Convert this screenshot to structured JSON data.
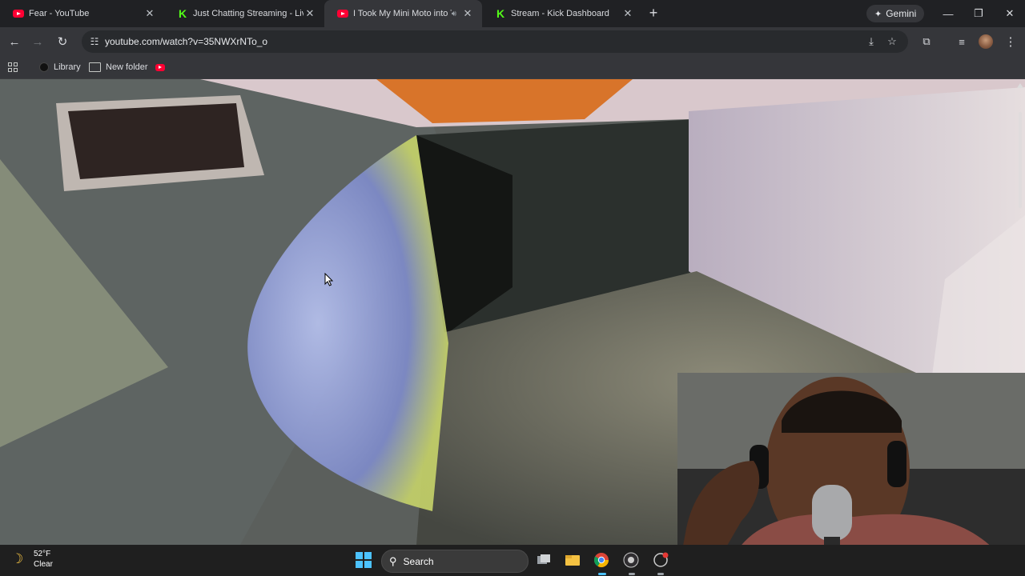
{
  "tabs": [
    {
      "title": "Fear - YouTube",
      "favicon": "youtube-favicon",
      "active": false
    },
    {
      "title": "Just Chatting Streaming - Live Streams on Kick",
      "favicon": "kick-favicon",
      "active": false
    },
    {
      "title": "I Took My Mini Moto into The Tunnels",
      "favicon": "youtube-favicon",
      "active": true,
      "audio_icon": "speaker-icon"
    },
    {
      "title": "Stream - Kick Dashboard",
      "favicon": "kick-favicon",
      "active": false
    }
  ],
  "tab_close_glyph": "✕",
  "new_tab_glyph": "+",
  "gemini": {
    "label": "Gemini",
    "icon": "gemini-sparkle-icon"
  },
  "window_controls": {
    "minimize": "—",
    "restore": "❐",
    "close": "✕"
  },
  "toolbar": {
    "back": "←",
    "forward": "→",
    "reload": "↻",
    "url": "youtube.com/watch?v=35NWXrNTo_o"
  },
  "bookmarks": [
    {
      "label": "Library",
      "icon": "library-icon"
    },
    {
      "label": "New folder",
      "icon": "folder-icon"
    },
    {
      "label": "",
      "icon": "youtube-bookmark-icon"
    }
  ],
  "taskbar": {
    "weather": {
      "temp": "52°F",
      "condition": "Clear",
      "icon": "moon-icon"
    },
    "search_label": "Search"
  },
  "colors": {
    "tab_bg": "#202124",
    "toolbar_bg": "#35363a",
    "youtube_red": "#ff0033",
    "kick_green": "#53fc18",
    "windows_blue": "#4cc2ff"
  }
}
